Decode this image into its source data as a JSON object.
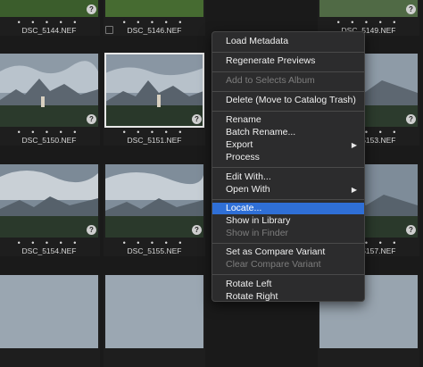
{
  "grid": {
    "row0_names": [
      "",
      "DSC_5144.NEF",
      "DSC_5146.NEF",
      "",
      "DSC_5149.NEF"
    ],
    "row1_names": [
      "",
      "DSC_5150.NEF",
      "DSC_5151.NEF",
      "",
      "DSC_5153.NEF"
    ],
    "row2_names": [
      "",
      "DSC_5154.NEF",
      "DSC_5155.NEF",
      "",
      "DSC_5157.NEF"
    ],
    "rating_dots": "• • • • •",
    "badge": "?"
  },
  "menu": {
    "load_metadata": "Load Metadata",
    "regenerate_previews": "Regenerate Previews",
    "add_to_selects_album": "Add to Selects Album",
    "delete": "Delete (Move to Catalog Trash)",
    "rename": "Rename",
    "batch_rename": "Batch Rename...",
    "export": "Export",
    "process": "Process",
    "edit_with": "Edit With...",
    "open_with": "Open With",
    "locate": "Locate...",
    "show_in_library": "Show in Library",
    "show_in_finder": "Show in Finder",
    "set_compare_variant": "Set as Compare Variant",
    "clear_compare_variant": "Clear Compare Variant",
    "rotate_left": "Rotate Left",
    "rotate_right": "Rotate Right",
    "submenu_arrow": "▶",
    "highlight_color": "#2f6fd6"
  }
}
